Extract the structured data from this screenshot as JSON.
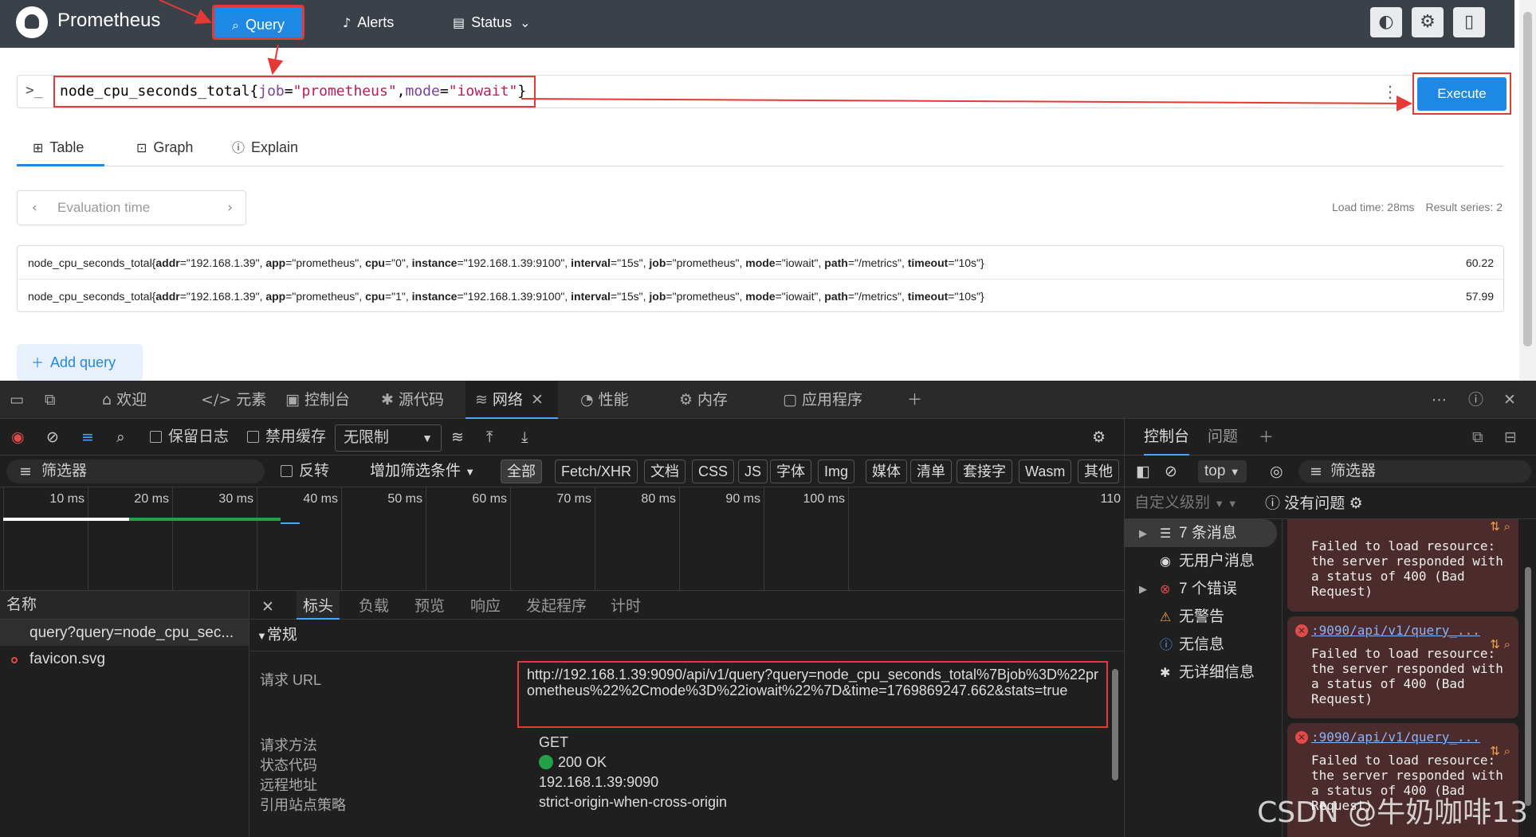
{
  "prometheus": {
    "brand": "Prometheus",
    "nav": {
      "query": "Query",
      "alerts": "Alerts",
      "status": "Status"
    },
    "expression_parts": [
      "node_cpu_seconds_total{",
      "job",
      "=",
      "\"prometheus\"",
      ",",
      "mode",
      "=",
      "\"iowait\"",
      "}"
    ],
    "execute": "Execute",
    "tabs": {
      "table": "Table",
      "graph": "Graph",
      "explain": "Explain"
    },
    "evaluation_time_placeholder": "Evaluation time",
    "load_time": "Load time: 28ms",
    "result_series": "Result series: 2",
    "results": [
      {
        "metric": "node_cpu_seconds_total",
        "labels": [
          [
            "addr",
            "192.168.1.39"
          ],
          [
            "app",
            "prometheus"
          ],
          [
            "cpu",
            "0"
          ],
          [
            "instance",
            "192.168.1.39:9100"
          ],
          [
            "interval",
            "15s"
          ],
          [
            "job",
            "prometheus"
          ],
          [
            "mode",
            "iowait"
          ],
          [
            "path",
            "/metrics"
          ],
          [
            "timeout",
            "10s"
          ]
        ],
        "value": "60.22"
      },
      {
        "metric": "node_cpu_seconds_total",
        "labels": [
          [
            "addr",
            "192.168.1.39"
          ],
          [
            "app",
            "prometheus"
          ],
          [
            "cpu",
            "1"
          ],
          [
            "instance",
            "192.168.1.39:9100"
          ],
          [
            "interval",
            "15s"
          ],
          [
            "job",
            "prometheus"
          ],
          [
            "mode",
            "iowait"
          ],
          [
            "path",
            "/metrics"
          ],
          [
            "timeout",
            "10s"
          ]
        ],
        "value": "57.99"
      }
    ],
    "add_query": "Add query"
  },
  "devtools": {
    "tabs": {
      "welcome": "欢迎",
      "elements": "元素",
      "console": "控制台",
      "sources": "源代码",
      "network": "网络",
      "performance": "性能",
      "memory": "内存",
      "application": "应用程序"
    },
    "toolbar": {
      "preserve_log": "保留日志",
      "disable_cache": "禁用缓存",
      "throttle": "无限制"
    },
    "filter": {
      "placeholder": "筛选器",
      "invert": "反转",
      "more_filters": "增加筛选条件",
      "chips": [
        "全部",
        "Fetch/XHR",
        "文档",
        "CSS",
        "JS",
        "字体",
        "Img",
        "媒体",
        "清单",
        "套接字",
        "Wasm",
        "其他"
      ]
    },
    "timeline_ticks": [
      "10 ms",
      "20 ms",
      "30 ms",
      "40 ms",
      "50 ms",
      "60 ms",
      "70 ms",
      "80 ms",
      "90 ms",
      "100 ms",
      "110"
    ],
    "request_list": {
      "header": "名称",
      "items": [
        "query?query=node_cpu_sec...",
        "favicon.svg"
      ]
    },
    "detail_tabs": {
      "headers": "标头",
      "payload": "负载",
      "preview": "预览",
      "response": "响应",
      "initiator": "发起程序",
      "timing": "计时"
    },
    "general": {
      "title": "常规",
      "url_label": "请求 URL",
      "url": "http://192.168.1.39:9090/api/v1/query?query=node_cpu_seconds_total%7Bjob%3D%22prometheus%22%2Cmode%3D%22iowait%22%7D&time=1769869247.662&stats=true",
      "method_label": "请求方法",
      "method": "GET",
      "status_label": "状态代码",
      "status": "200 OK",
      "remote_label": "远程地址",
      "remote": "192.168.1.39:9090",
      "referrer_label": "引用站点策略",
      "referrer": "strict-origin-when-cross-origin"
    },
    "console_panel": {
      "tab_console": "控制台",
      "tab_issues": "问题",
      "context": "top",
      "filter": "筛选器",
      "levels": "自定义级别",
      "no_issues": "没有问题",
      "sidebar": [
        "7 条消息",
        "无用户消息",
        "7 个错误",
        "无警告",
        "无信息",
        "无详细信息"
      ],
      "msg_text": "Failed to load resource: the server responded with a status of 400 (Bad Request)",
      "msg_link": ":9090/api/v1/query_..."
    }
  },
  "watermark": "CSDN @牛奶咖啡13"
}
